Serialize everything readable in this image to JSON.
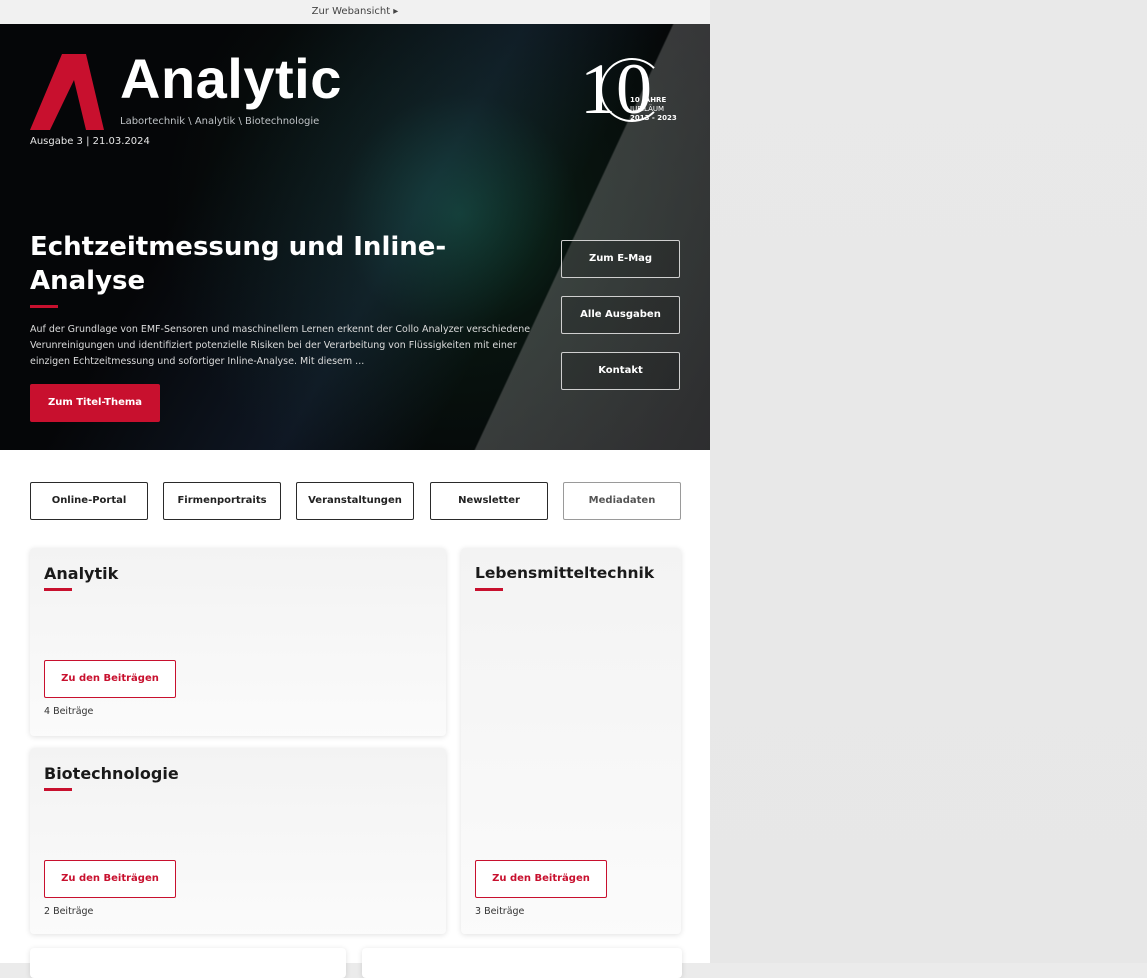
{
  "topbar": {
    "webview_link": "Zur Webansicht ▸"
  },
  "hero": {
    "brand": "Analytic",
    "tagline": "Labortechnik \\ Analytik \\ Biotechnologie",
    "issue": "Ausgabe 3 | 21.03.2024",
    "jubilee": {
      "number": "10",
      "line1": "10 JAHRE",
      "line2": "JUBILÄUM",
      "line3": "2013 - 2023"
    },
    "title": "Echtzeitmessung und Inline-Analyse",
    "text": "Auf der Grundlage von EMF-Sensoren und maschinellem Lernen erkennt der Collo Analyzer verschiedene Verunreinigungen und identifiziert potenzielle Risiken bei der Verarbeitung von Flüssigkeiten mit einer einzigen Echtzeitmessung und sofortiger Inline-Analyse. Mit diesem ...",
    "cta": "Zum Titel-Thema",
    "side_buttons": [
      "Zum E-Mag",
      "Alle Ausgaben",
      "Kontakt"
    ]
  },
  "nav": [
    "Online-Portal",
    "Firmenportraits",
    "Veranstaltungen",
    "Newsletter",
    "Mediadaten"
  ],
  "cards": [
    {
      "title": "Analytik",
      "button": "Zu den Beiträgen",
      "count": "4 Beiträge"
    },
    {
      "title": "Lebensmitteltechnik",
      "button": "Zu den Beiträgen",
      "count": "3 Beiträge"
    },
    {
      "title": "Biotechnologie",
      "button": "Zu den Beiträgen",
      "count": "2 Beiträge"
    }
  ],
  "colors": {
    "accent": "#c8102e",
    "hero_bg": "#0a0a0a"
  }
}
